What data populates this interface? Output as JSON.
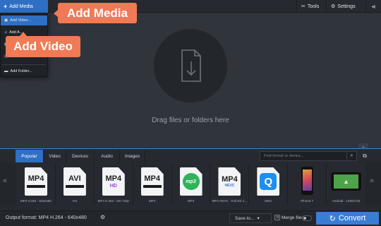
{
  "toolbar": {
    "add_media_label": "Add Media",
    "tools_label": "Tools",
    "settings_label": "Settings"
  },
  "dropdown": {
    "items": [
      {
        "label": "Add Video...",
        "icon": "video-icon"
      },
      {
        "label": "Add A...",
        "icon": "music-icon"
      },
      {
        "label": "",
        "icon": "image-icon"
      },
      {
        "label": "",
        "icon": "dvd-icon"
      },
      {
        "label": "Add Folder...",
        "icon": "folder-icon"
      }
    ]
  },
  "callouts": {
    "media": "Add Media",
    "video": "Add Video"
  },
  "dropzone": {
    "text": "Drag files or folders here"
  },
  "format_panel": {
    "tabs": [
      {
        "label": "Popular",
        "active": true
      },
      {
        "label": "Video",
        "active": false
      },
      {
        "label": "Devices",
        "active": false
      },
      {
        "label": "Audio",
        "active": false
      },
      {
        "label": "Images",
        "active": false
      }
    ],
    "search_placeholder": "Find format or device...",
    "formats": [
      {
        "kind": "doc",
        "big": "MP4",
        "sub": "",
        "label": "MP4 H.264 - 640x480"
      },
      {
        "kind": "doc",
        "big": "AVI",
        "sub": "",
        "label": "AVI"
      },
      {
        "kind": "doc",
        "big": "MP4",
        "sub": "HD",
        "label": "MP4 H.264 - HD 720p"
      },
      {
        "kind": "doc",
        "big": "MP4",
        "sub": "",
        "label": "MP4"
      },
      {
        "kind": "mp3",
        "big": "mp3",
        "sub": "",
        "label": "MP3"
      },
      {
        "kind": "doc",
        "big": "MP4",
        "sub": "HEVC",
        "label": "MP4 HEVC - Full HD 1..."
      },
      {
        "kind": "mov",
        "big": "Q",
        "sub": "",
        "label": "MOV"
      },
      {
        "kind": "phone",
        "big": "",
        "sub": "",
        "label": "iPhone 7"
      },
      {
        "kind": "tablet",
        "big": "",
        "sub": "",
        "label": "Android - 1280x720"
      }
    ]
  },
  "bottom": {
    "output_label": "Output format: MP4 H.264 - 640x480",
    "save_label": "Save to...",
    "merge_label": "Merge files",
    "convert_label": "Convert"
  },
  "colors": {
    "accent": "#2f6fc4",
    "callout": "#f07a55",
    "convert": "#3a7dd4"
  }
}
